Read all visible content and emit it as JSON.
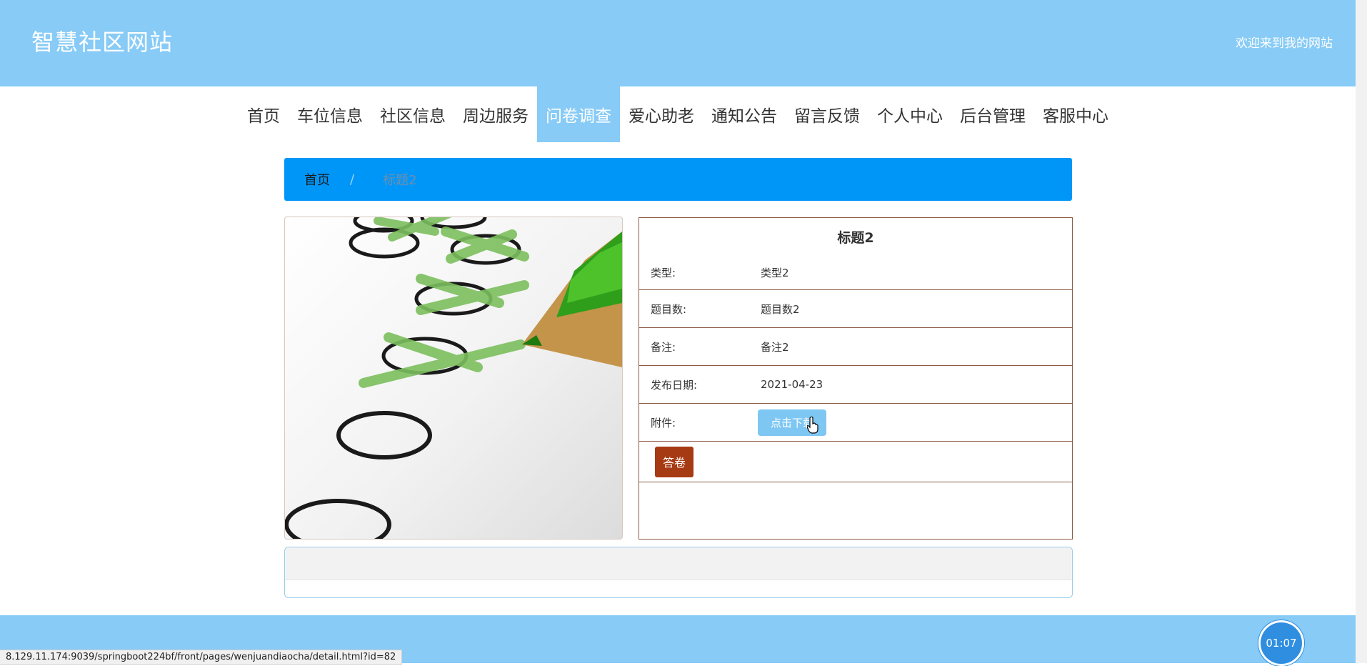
{
  "header": {
    "site_title": "智慧社区网站",
    "welcome": "欢迎来到我的网站"
  },
  "nav": {
    "items": [
      {
        "label": "首页"
      },
      {
        "label": "车位信息"
      },
      {
        "label": "社区信息"
      },
      {
        "label": "周边服务"
      },
      {
        "label": "问卷调查",
        "active": true
      },
      {
        "label": "爱心助老"
      },
      {
        "label": "通知公告"
      },
      {
        "label": "留言反馈"
      },
      {
        "label": "个人中心"
      },
      {
        "label": "后台管理"
      },
      {
        "label": "客服中心"
      }
    ]
  },
  "breadcrumb": {
    "home": "首页",
    "separator": "/",
    "current": "标题2"
  },
  "detail": {
    "title": "标题2",
    "rows": [
      {
        "label": "类型:",
        "value": "类型2"
      },
      {
        "label": "题目数:",
        "value": "题目数2"
      },
      {
        "label": "备注:",
        "value": "备注2"
      },
      {
        "label": "发布日期:",
        "value": "2021-04-23"
      }
    ],
    "attachment_label": "附件:",
    "download_label": "点击下载",
    "answer_label": "答卷"
  },
  "image": {
    "icon": "survey-checklist-pencil"
  },
  "timer": {
    "value": "01:07"
  },
  "status_bar": {
    "url": "8.129.11.174:9039/springboot224bf/front/pages/wenjuandiaocha/detail.html?id=82"
  },
  "colors": {
    "header_bg": "#87cbf6",
    "breadcrumb_bg": "#0096f8",
    "answer_btn": "#a63a12",
    "download_btn": "#7fc7f3",
    "detail_border": "#8c5a46"
  }
}
